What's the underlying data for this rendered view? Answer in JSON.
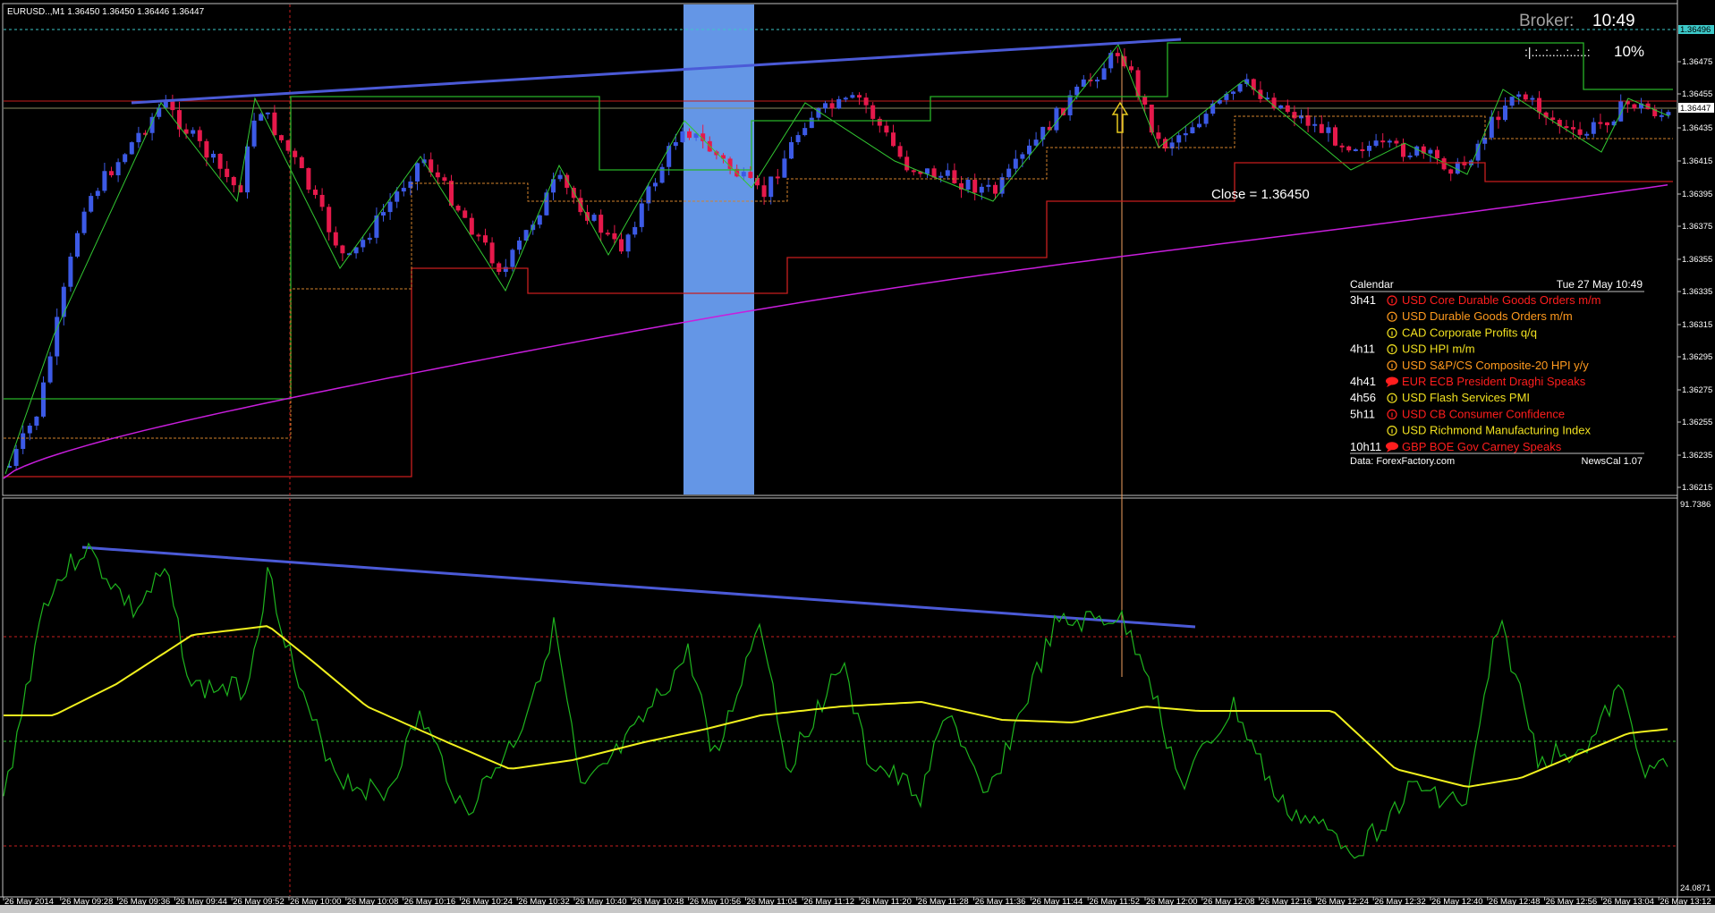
{
  "chart_header": {
    "symbol_line": "EURUSD..,M1  1.36450 1.36450 1.36446 1.36447"
  },
  "broker_clock": {
    "label": "Broker:",
    "time": "10:49",
    "progress_glyphs": ":|.:..:..:..:..:..:",
    "percent": "10%",
    "percent_value": 10
  },
  "close_label": "Close = 1.36450",
  "calendar": {
    "title": "Calendar",
    "date": "Tue 27 May 10:49",
    "events": [
      {
        "time": "3h41",
        "icon": "info-icon",
        "text": "USD Core Durable Goods Orders m/m",
        "color": "#ff1e1e"
      },
      {
        "time": "",
        "icon": "info-icon",
        "text": "USD Durable Goods Orders m/m",
        "color": "#ff9a1e"
      },
      {
        "time": "",
        "icon": "info-icon",
        "text": "CAD Corporate Profits q/q",
        "color": "#f0e020"
      },
      {
        "time": "4h11",
        "icon": "info-icon",
        "text": "USD HPI m/m",
        "color": "#f0e020"
      },
      {
        "time": "",
        "icon": "info-icon",
        "text": "USD S&P/CS Composite-20 HPI y/y",
        "color": "#ff9a1e"
      },
      {
        "time": "4h41",
        "icon": "speech-icon",
        "text": "EUR ECB President Draghi Speaks",
        "color": "#ff1e1e"
      },
      {
        "time": "4h56",
        "icon": "info-icon",
        "text": "USD Flash Services PMI",
        "color": "#f0e020"
      },
      {
        "time": "5h11",
        "icon": "info-icon",
        "text": "USD CB Consumer Confidence",
        "color": "#ff1e1e"
      },
      {
        "time": "",
        "icon": "info-icon",
        "text": "USD Richmond Manufacturing Index",
        "color": "#f0e020"
      },
      {
        "time": "10h11",
        "icon": "speech-icon",
        "text": "GBP BOE Gov Carney Speaks",
        "color": "#ff1e1e"
      }
    ],
    "source": "Data: ForexFactory.com",
    "version": "NewsCal 1.07"
  },
  "price_axis": {
    "ticks": [
      "1.36496",
      "1.36475",
      "1.36455",
      "1.36447",
      "1.36435",
      "1.36415",
      "1.36395",
      "1.36375",
      "1.36355",
      "1.36335",
      "1.36315",
      "1.36295",
      "1.36275",
      "1.36255",
      "1.36235",
      "1.36215"
    ],
    "current_price": "1.36447",
    "top_marker": "1.36496"
  },
  "indicator_axis": {
    "max": "91.7386",
    "min": "24.0871"
  },
  "time_axis": [
    "26 May 2014",
    "26 May 09:28",
    "26 May 09:36",
    "26 May 09:44",
    "26 May 09:52",
    "26 May 10:00",
    "26 May 10:08",
    "26 May 10:16",
    "26 May 10:24",
    "26 May 10:32",
    "26 May 10:40",
    "26 May 10:48",
    "26 May 10:56",
    "26 May 11:04",
    "26 May 11:12",
    "26 May 11:20",
    "26 May 11:28",
    "26 May 11:36",
    "26 May 11:44",
    "26 May 11:52",
    "26 May 12:00",
    "26 May 12:08",
    "26 May 12:16",
    "26 May 12:24",
    "26 May 12:32",
    "26 May 12:40",
    "26 May 12:48",
    "26 May 12:56",
    "26 May 13:04",
    "26 May 13:12"
  ],
  "colors": {
    "bull_candle": "#3c5ae6",
    "bear_candle": "#e6194b",
    "trendline": "#4b5ad7",
    "zigzag": "#32c832",
    "ma_magenta": "#c81edc",
    "osc_green": "#1eb41e",
    "osc_signal": "#f0f01e",
    "session_box": "#6496e6",
    "level_red": "#c81e1e"
  }
}
